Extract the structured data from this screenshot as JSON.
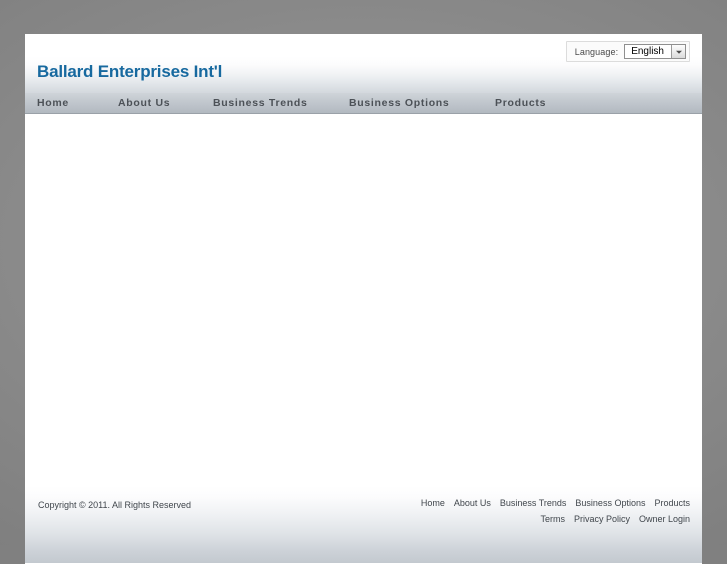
{
  "header": {
    "site_title": "Ballard Enterprises Int'l",
    "language": {
      "label": "Language:",
      "selected": "English",
      "arrow_icon": "chevron-down-icon"
    }
  },
  "nav": {
    "items": [
      {
        "label": "Home"
      },
      {
        "label": "About Us"
      },
      {
        "label": "Business Trends"
      },
      {
        "label": "Business Options"
      },
      {
        "label": "Products"
      }
    ]
  },
  "content": {
    "body_text": ""
  },
  "footer": {
    "copyright": "Copyright © 2011. All Rights Reserved",
    "links_row1": [
      {
        "label": "Home"
      },
      {
        "label": "About Us"
      },
      {
        "label": "Business Trends"
      },
      {
        "label": "Business Options"
      },
      {
        "label": "Products"
      }
    ],
    "links_row2": [
      {
        "label": "Terms"
      },
      {
        "label": "Privacy Policy"
      },
      {
        "label": "Owner Login"
      }
    ]
  },
  "colors": {
    "brand_blue": "#17699f",
    "nav_text": "#4c5157",
    "desktop_gray": "#8a8a8a",
    "page_white": "#ffffff"
  }
}
